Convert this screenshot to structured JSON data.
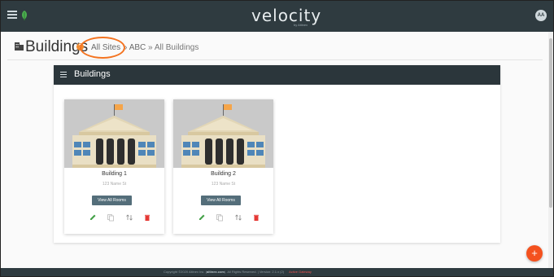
{
  "topbar": {
    "brand": "velocity",
    "brand_sub": "by Altinex",
    "avatar_initials": "AA"
  },
  "header": {
    "title": "Buildings",
    "help_glyph": "?",
    "breadcrumb": {
      "site_link": "All Sites",
      "sep1": "»",
      "org": "ABC",
      "sep2": "»",
      "current": "All Buildings"
    }
  },
  "panel": {
    "title": "Buildings"
  },
  "buildings": [
    {
      "name": "Building 1",
      "address": "123 Name St",
      "view_label": "View All Rooms"
    },
    {
      "name": "Building 2",
      "address": "123 Name St",
      "view_label": "View All Rooms"
    }
  ],
  "fab": {
    "label": "+"
  },
  "footer": {
    "copyright_pre": "Copyright ©2020 Altinex Inc. (",
    "site": "altinex.com",
    "copyright_post": "). All Rights Reserved. | Version: 2.1.x (2)",
    "gateway": "Active Gateway"
  },
  "colors": {
    "topbar": "#2f3b40",
    "accent_orange": "#f47421",
    "edit": "#43a047",
    "delete": "#e53935",
    "button": "#546e7a"
  },
  "icons": {
    "menu": "hamburger-icon",
    "leaf": "leaf-icon",
    "building": "building-icon",
    "help": "help-icon",
    "edit": "pencil-icon",
    "copy": "copy-icon",
    "move": "move-icon",
    "delete": "trash-icon",
    "add": "plus-icon"
  }
}
